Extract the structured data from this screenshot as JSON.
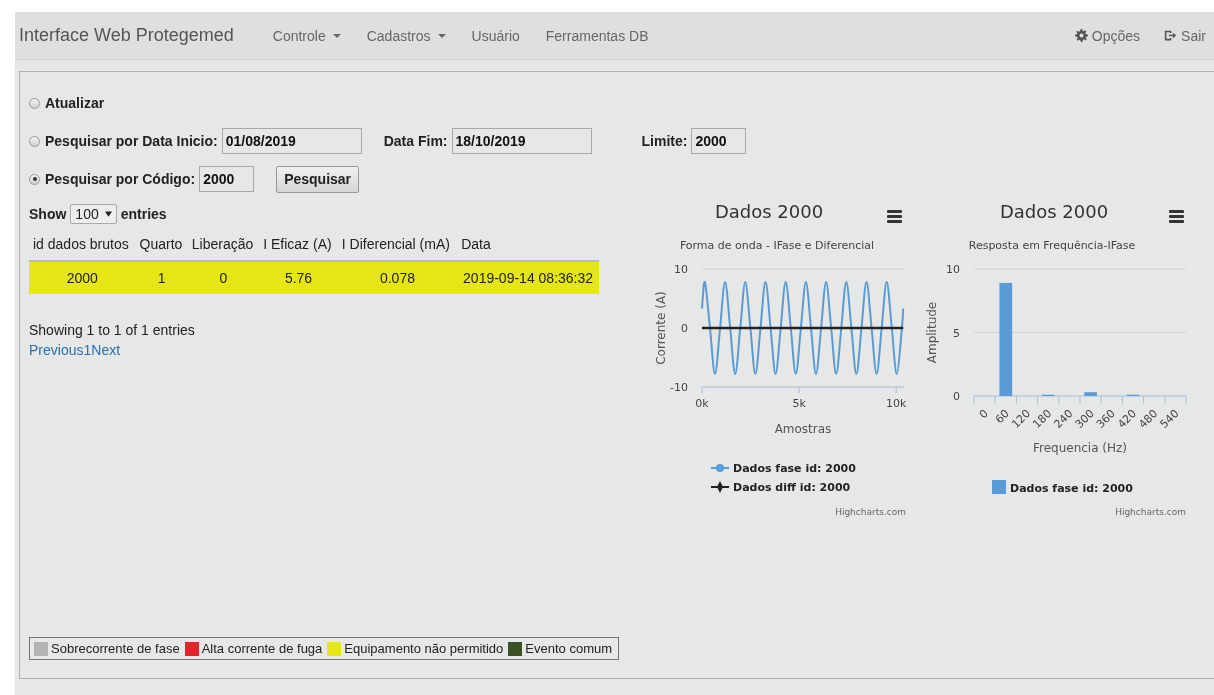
{
  "navbar": {
    "brand": "Interface Web Protegemed",
    "menu": [
      {
        "label": "Controle",
        "dropdown": true
      },
      {
        "label": "Cadastros",
        "dropdown": true
      },
      {
        "label": "Usuário",
        "dropdown": false
      },
      {
        "label": "Ferramentas DB",
        "dropdown": false
      }
    ],
    "right": [
      {
        "label": "Opções"
      },
      {
        "label": "Sair"
      }
    ]
  },
  "search": {
    "options": [
      {
        "kind": "plain",
        "label": "Atualizar",
        "selected": false
      },
      {
        "kind": "dates",
        "label": "Pesquisar por Data Inicio:",
        "selected": false,
        "value": "01/08/2019",
        "end_label": "Data Fim:",
        "end_value": "18/10/2019",
        "limit_label": "Limite:",
        "limit_value": "2000"
      },
      {
        "kind": "code",
        "label": "Pesquisar por Código:",
        "selected": true,
        "value": "2000",
        "button": "Pesquisar"
      }
    ]
  },
  "table": {
    "length": {
      "prefix": "Show",
      "value": "100",
      "suffix": "entries"
    },
    "columns": [
      "id dados brutos",
      "Quarto",
      "Liberação",
      "I Eficaz (A)",
      "I Diferencial (mA)",
      "Data"
    ],
    "rows": [
      {
        "color": "#e6e614",
        "cells": [
          "2000",
          "1",
          "0",
          "5.76",
          "0.078",
          "2019-09-14 08:36:32"
        ]
      }
    ],
    "info": "Showing 1 to 1 of 1 entries",
    "pagination": [
      "Previous",
      "1",
      "Next"
    ]
  },
  "charts": [
    {
      "subtitle": "Forma de onda - IFase e Diferencial",
      "credits": "Highcharts.com",
      "chart_data": {
        "type": "line",
        "title": "Dados 2000",
        "legend": true,
        "xlabel": "Amostras",
        "ylabel": "Corrente (A)",
        "xlim": [
          0,
          10400
        ],
        "ylim": [
          -10,
          10
        ],
        "xticks": [
          {
            "value": 0,
            "label": "0k"
          },
          {
            "value": 5000,
            "label": "5k"
          },
          {
            "value": 10000,
            "label": "10k"
          }
        ],
        "yticks": [
          {
            "value": -10,
            "label": "-10"
          },
          {
            "value": 0,
            "label": "0"
          },
          {
            "value": 10,
            "label": "10"
          }
        ],
        "x": [
          0,
          150,
          410,
          670,
          930,
          1190,
          1450,
          1710,
          1970,
          2230,
          2490,
          2750,
          3010,
          3270,
          3530,
          3790,
          4050,
          4310,
          4570,
          4830,
          5090,
          5350,
          5610,
          5870,
          6130,
          6390,
          6650,
          6910,
          7170,
          7430,
          7690,
          7950,
          8210,
          8470,
          8730,
          8990,
          9250,
          9510,
          9770,
          10030,
          10290,
          10360
        ],
        "series": [
          {
            "name": "Dados fase id: 2000",
            "color": "#5b9bd5",
            "values": [
              3.3,
              7.8,
              0,
              -7.8,
              0,
              7.8,
              0,
              -7.8,
              0,
              7.8,
              0,
              -7.8,
              0,
              7.8,
              0,
              -7.8,
              0,
              7.8,
              0,
              -7.8,
              0,
              7.8,
              0,
              -7.8,
              0,
              7.8,
              0,
              -7.8,
              0,
              7.8,
              0,
              -7.8,
              0,
              7.8,
              0,
              -7.8,
              0,
              7.8,
              0,
              -7.8,
              0,
              3.3
            ]
          },
          {
            "name": "Dados diff id: 2000",
            "color": "#222222",
            "values": [
              0,
              0,
              0,
              0,
              0,
              0,
              0,
              0,
              0,
              0,
              0,
              0,
              0,
              0,
              0,
              0,
              0,
              0,
              0,
              0,
              0,
              0,
              0,
              0,
              0,
              0,
              0,
              0,
              0,
              0,
              0,
              0,
              0,
              0,
              0,
              0,
              0,
              0,
              0,
              0,
              0,
              0
            ]
          }
        ]
      }
    },
    {
      "subtitle": "Resposta em Frequência-IFase",
      "credits": "Highcharts.com",
      "chart_data": {
        "type": "bar",
        "title": "Dados 2000",
        "legend": true,
        "xlabel": "Frequencia (Hz)",
        "ylabel": "Amplitude",
        "ylim": [
          0,
          10
        ],
        "yticks": [
          {
            "value": 0,
            "label": "0"
          },
          {
            "value": 5,
            "label": "5"
          },
          {
            "value": 10,
            "label": "10"
          }
        ],
        "categories": [
          "0",
          "60",
          "120",
          "180",
          "240",
          "300",
          "360",
          "420",
          "480",
          "540"
        ],
        "series": [
          {
            "name": "Dados fase id: 2000",
            "color": "#5b9bd5",
            "values": [
              0,
              8.9,
              0,
              0.1,
              0,
              0.3,
              0,
              0.1,
              0,
              0
            ]
          }
        ]
      }
    }
  ],
  "legend": [
    {
      "label": "Sobrecorrente de fase",
      "color": "#b3b3b3"
    },
    {
      "label": "Alta corrente de fuga",
      "color": "#e8202a"
    },
    {
      "label": "Equipamento não permitido",
      "color": "#e6e614"
    },
    {
      "label": "Evento comum",
      "color": "#3b5323"
    }
  ]
}
